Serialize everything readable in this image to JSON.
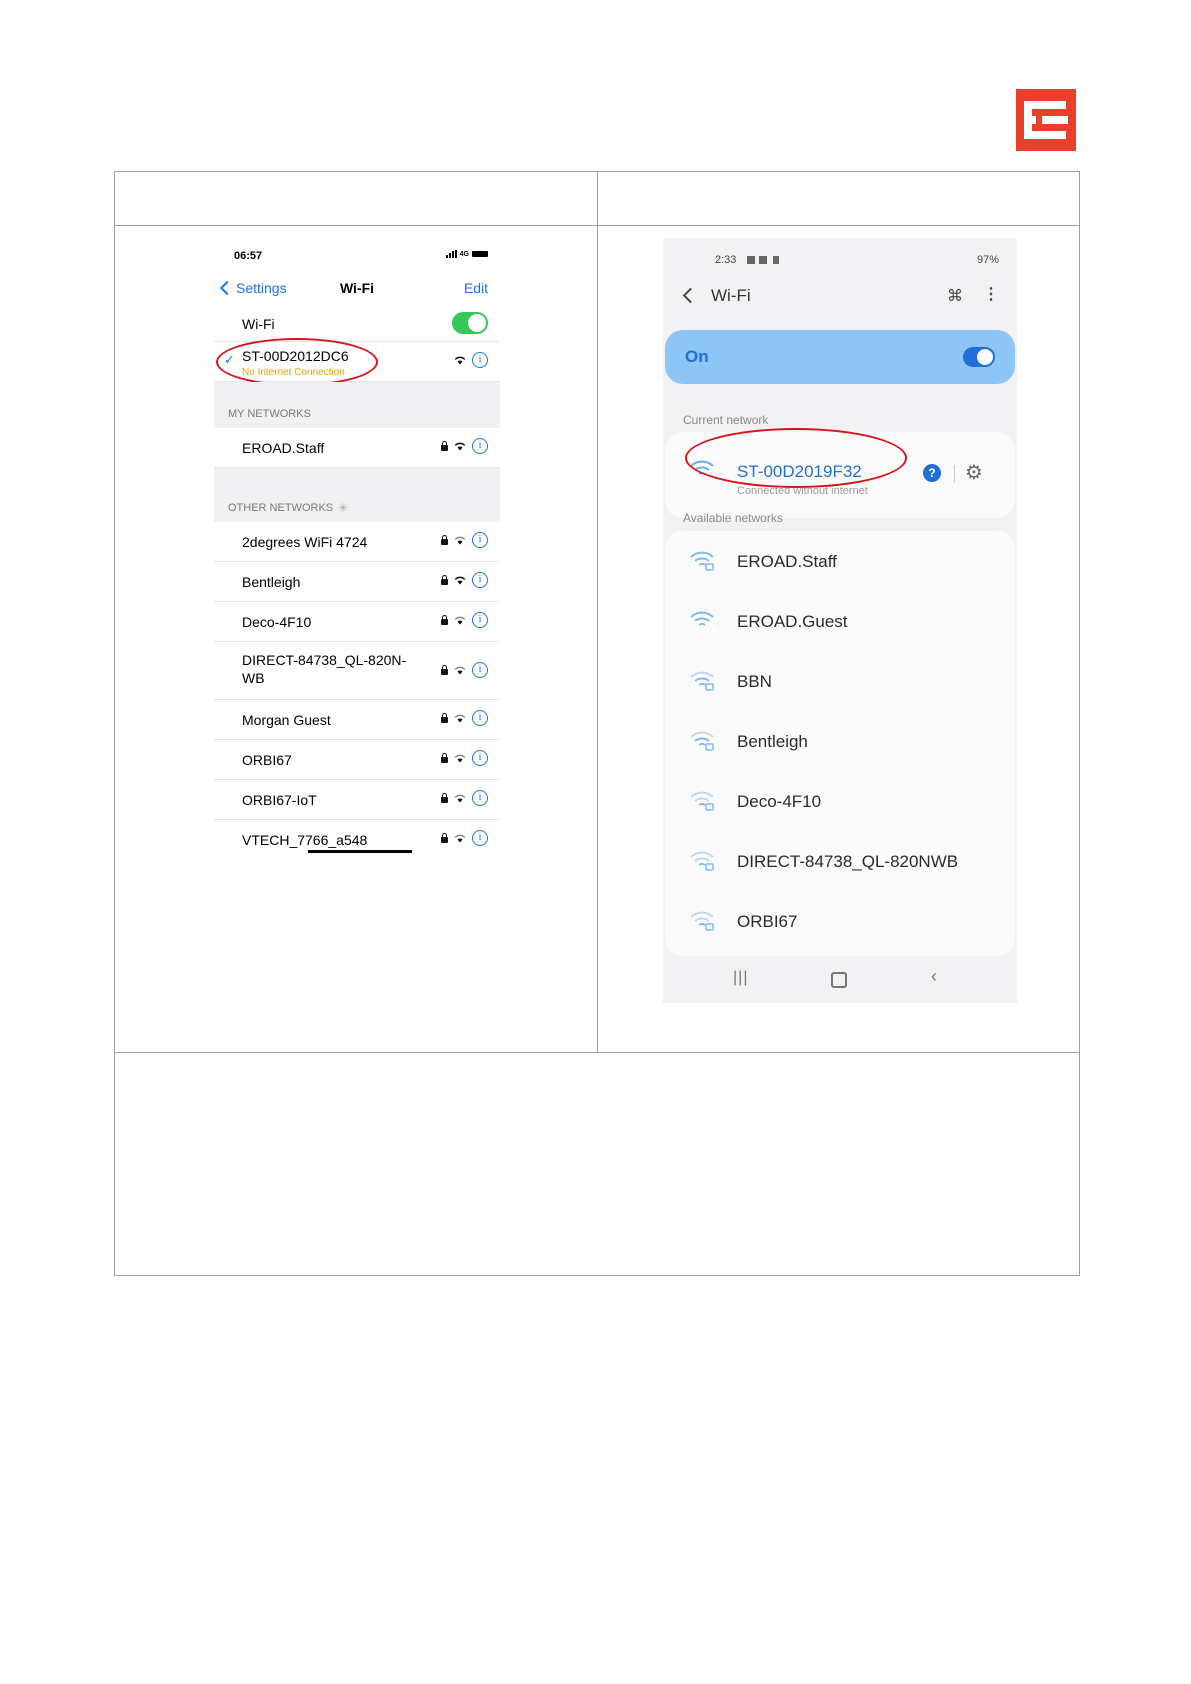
{
  "logo": {
    "name": "EROAD logo",
    "color": "#e8402a"
  },
  "ios": {
    "time": "06:57",
    "network_type": "4G",
    "back_label": "Settings",
    "title": "Wi-Fi",
    "edit_label": "Edit",
    "wifi_label": "Wi-Fi",
    "connected": {
      "name": "ST-00D2012DC6",
      "status": "No Internet Connection"
    },
    "my_networks_header": "MY NETWORKS",
    "my_networks": [
      {
        "name": "EROAD.Staff"
      }
    ],
    "other_networks_header": "OTHER NETWORKS",
    "other_networks": [
      {
        "name": "2degrees WiFi 4724"
      },
      {
        "name": "Bentleigh"
      },
      {
        "name": "Deco-4F10"
      },
      {
        "name": "DIRECT-84738_QL-820N-",
        "name2": "WB"
      },
      {
        "name": "Morgan Guest"
      },
      {
        "name": "ORBI67"
      },
      {
        "name": "ORBI67-IoT"
      },
      {
        "name": "VTECH_7766_a548"
      }
    ],
    "accent_color": "#1a73e8",
    "toggle_color": "#34c759"
  },
  "android": {
    "time": "2:33",
    "status_right": "97%",
    "title": "Wi-Fi",
    "on_label": "On",
    "current_network_label": "Current network",
    "current": {
      "name": "ST-00D2019F32",
      "status": "Connected without internet"
    },
    "available_label": "Available networks",
    "available": [
      {
        "name": "EROAD.Staff",
        "secured": true
      },
      {
        "name": "EROAD.Guest",
        "secured": false
      },
      {
        "name": "BBN",
        "secured": true
      },
      {
        "name": "Bentleigh",
        "secured": true
      },
      {
        "name": "Deco-4F10",
        "secured": true
      },
      {
        "name": "DIRECT-84738_QL-820NWB",
        "secured": true
      },
      {
        "name": "ORBI67",
        "secured": true
      }
    ],
    "accent_color": "#1f6fd6",
    "highlight_color": "#d6141b"
  }
}
